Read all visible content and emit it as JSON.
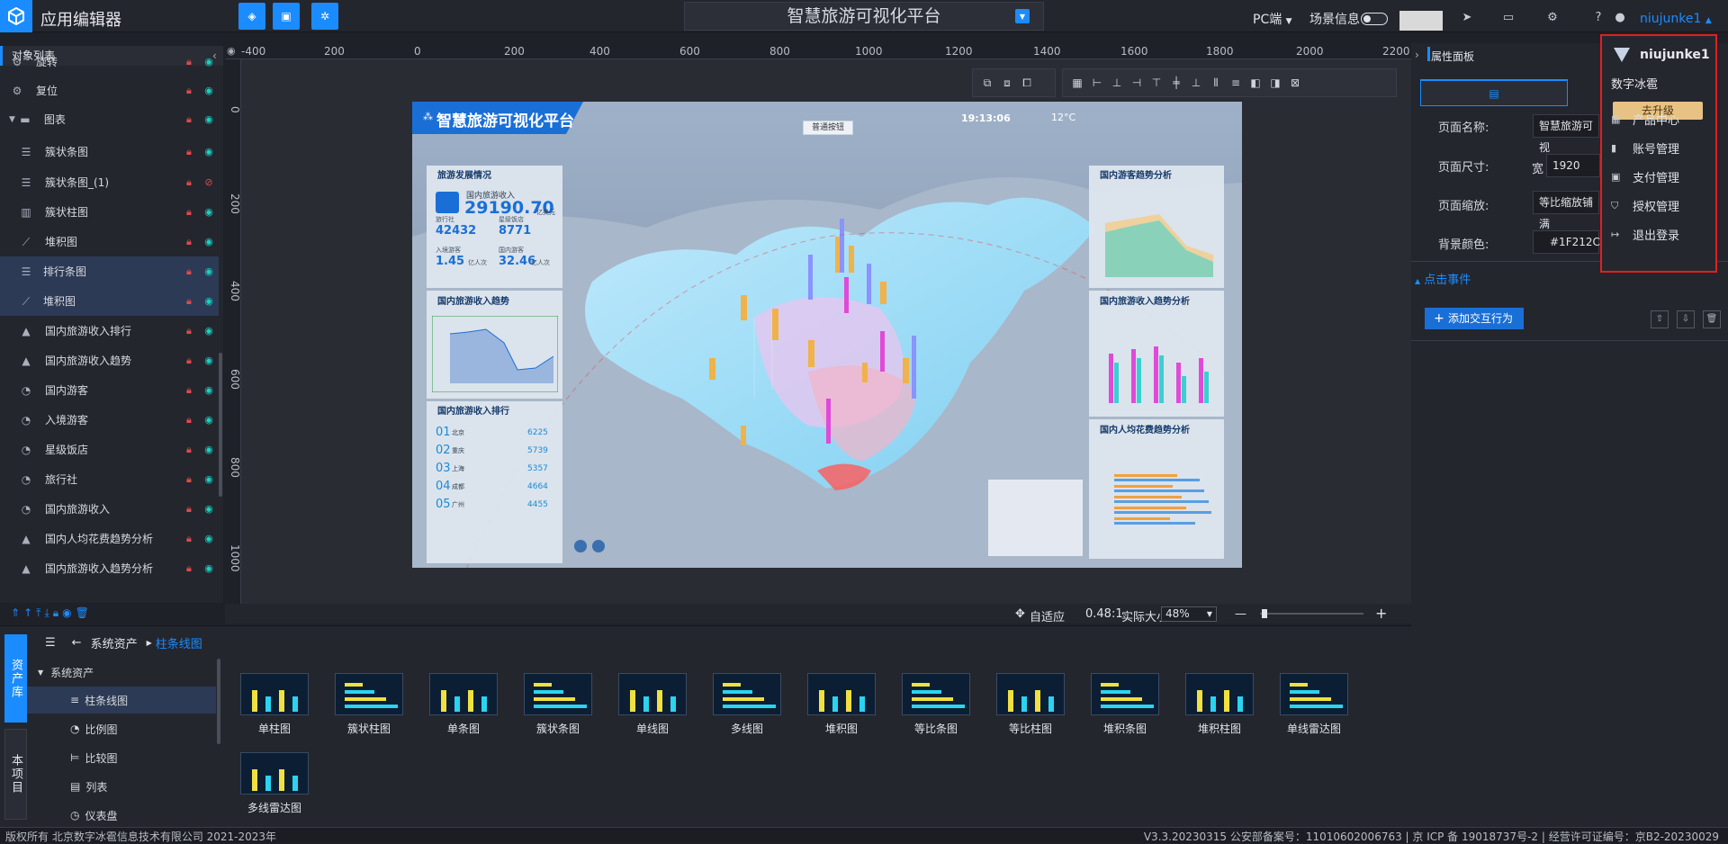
{
  "app": {
    "name": "应用编辑器"
  },
  "header": {
    "project_title": "智慧旅游可视化平台",
    "platform": "PC端",
    "scene_info_label": "场景信息",
    "username": "niujunke1"
  },
  "left_panel": {
    "title": "对象列表",
    "items": [
      {
        "label": "旋转",
        "icon": "gear-icon",
        "hidden": false
      },
      {
        "label": "复位",
        "icon": "gear-icon",
        "hidden": false
      },
      {
        "label": "图表",
        "icon": "folder-icon",
        "hidden": false
      },
      {
        "label": "簇状条图",
        "icon": "bar-chart-icon",
        "hidden": false
      },
      {
        "label": "簇状条图_(1)",
        "icon": "bar-chart-icon",
        "hidden": true
      },
      {
        "label": "簇状柱图",
        "icon": "column-chart-icon",
        "hidden": false
      },
      {
        "label": "堆积图",
        "icon": "line-chart-icon",
        "hidden": false
      },
      {
        "label": "排行条图",
        "icon": "bar-chart-icon",
        "hidden": false
      },
      {
        "label": "堆积图",
        "icon": "line-chart-icon",
        "hidden": false
      },
      {
        "label": "国内旅游收入排行",
        "icon": "mountain-icon",
        "hidden": false
      },
      {
        "label": "国内旅游收入趋势",
        "icon": "mountain-icon",
        "hidden": false
      },
      {
        "label": "国内游客",
        "icon": "gauge-icon",
        "hidden": false
      },
      {
        "label": "入境游客",
        "icon": "gauge-icon",
        "hidden": false
      },
      {
        "label": "星级饭店",
        "icon": "gauge-icon",
        "hidden": false
      },
      {
        "label": "旅行社",
        "icon": "gauge-icon",
        "hidden": false
      },
      {
        "label": "国内旅游收入",
        "icon": "gauge-icon",
        "hidden": false
      },
      {
        "label": "国内人均花费趋势分析",
        "icon": "mountain-icon",
        "hidden": false
      },
      {
        "label": "国内旅游收入趋势分析",
        "icon": "mountain-icon",
        "hidden": false
      }
    ]
  },
  "canvas": {
    "ruler_h": [
      "-400",
      "200",
      "0",
      "200",
      "400",
      "600",
      "800",
      "1000",
      "1200",
      "1400",
      "1600",
      "1800",
      "2000",
      "2200"
    ],
    "ruler_v": [
      "0",
      "200",
      "400",
      "600",
      "800",
      "1000"
    ],
    "fit_label": "自适应",
    "ratio_label": "0.48:1",
    "actual_size_label": "实际大小",
    "zoom": "48%"
  },
  "scene": {
    "title": "智慧旅游可视化平台",
    "time": "19:13:06",
    "temp": "12°C",
    "center_button": "普通按钮",
    "panels": {
      "dev": "旅游发展情况",
      "income_label": "国内旅游收入",
      "income": "29190.70",
      "income_unit": "亿美元",
      "stats": [
        {
          "label": "旅行社",
          "value": "42432"
        },
        {
          "label": "星级饭店",
          "value": "8771"
        },
        {
          "label": "入境游客",
          "value": "1.45",
          "unit": "亿人次"
        },
        {
          "label": "国内游客",
          "value": "32.46",
          "unit": "亿人次"
        }
      ],
      "trend": "国内旅游收入趋势",
      "rank": "国内旅游收入排行",
      "rank_rows": [
        {
          "no": "01",
          "city": "北京",
          "value": "6225"
        },
        {
          "no": "02",
          "city": "重庆",
          "value": "5739"
        },
        {
          "no": "03",
          "city": "上海",
          "value": "5357"
        },
        {
          "no": "04",
          "city": "成都",
          "value": "4664"
        },
        {
          "no": "05",
          "city": "广州",
          "value": "4455"
        }
      ],
      "visitors": "国内游客趋势分析",
      "income_trend": "国内旅游收入趋势分析",
      "spending": "国内人均花费趋势分析"
    }
  },
  "right_panel": {
    "title": "属性面板",
    "page_name_label": "页面名称:",
    "page_name_value": "智慧旅游可视",
    "page_size_label": "页面尺寸:",
    "width_label": "宽",
    "width_value": "1920",
    "page_scale_label": "页面缩放:",
    "page_scale_value": "等比缩放铺满",
    "bg_color_label": "背景颜色:",
    "bg_color_value": "#1F212C",
    "event_header": "点击事件",
    "add_interaction": "添加交互行为"
  },
  "user_menu": {
    "username": "niujunke1",
    "company": "数字冰雹",
    "upgrade": "去升级",
    "items": [
      {
        "label": "产品中心",
        "icon": "grid-icon"
      },
      {
        "label": "账号管理",
        "icon": "bookmark-icon"
      },
      {
        "label": "支付管理",
        "icon": "wallet-icon"
      },
      {
        "label": "授权管理",
        "icon": "shield-icon"
      },
      {
        "label": "退出登录",
        "icon": "logout-icon"
      }
    ]
  },
  "assets": {
    "tab_assets": "资产库",
    "tab_project": "本项目",
    "breadcrumb_root": "系统资产",
    "breadcrumb_current": "柱条线图",
    "tree": [
      {
        "label": "系统资产"
      },
      {
        "label": "柱条线图"
      },
      {
        "label": "比例图"
      },
      {
        "label": "比较图"
      },
      {
        "label": "列表"
      },
      {
        "label": "仪表盘"
      }
    ],
    "thumbs": [
      {
        "label": "单柱图"
      },
      {
        "label": "簇状柱图"
      },
      {
        "label": "单条图"
      },
      {
        "label": "簇状条图"
      },
      {
        "label": "单线图"
      },
      {
        "label": "多线图"
      },
      {
        "label": "堆积图"
      },
      {
        "label": "等比条图"
      },
      {
        "label": "等比柱图"
      },
      {
        "label": "堆积条图"
      },
      {
        "label": "堆积柱图"
      },
      {
        "label": "单线雷达图"
      },
      {
        "label": "多线雷达图"
      }
    ]
  },
  "footer": {
    "left": "版权所有 北京数字冰雹信息技术有限公司 2021-2023年",
    "right": "V3.3.20230315 公安部备案号：11010602006763 | 京 ICP 备 19018737号-2 | 经营许可证编号：京B2-20230029"
  }
}
